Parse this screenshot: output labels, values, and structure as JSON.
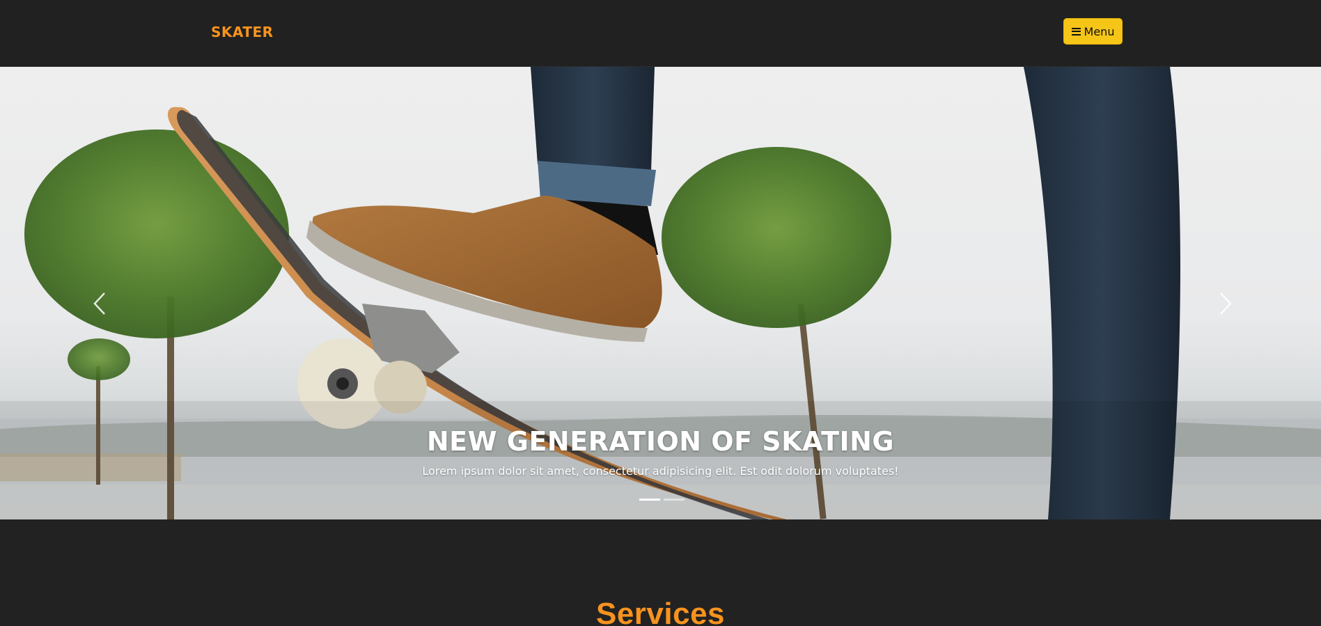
{
  "header": {
    "brand": "SKATER",
    "menu_label": "Menu",
    "menu_icon": "hamburger-icon"
  },
  "hero": {
    "title": "NEW GENERATION OF SKATING",
    "subtitle": "Lorem ipsum dolor sit amet, consectetur adipisicing elit. Est odit dolorum voluptates!",
    "prev_icon": "chevron-left-icon",
    "next_icon": "chevron-right-icon",
    "slides": [
      {
        "active": true
      },
      {
        "active": false
      }
    ]
  },
  "services": {
    "title": "Services"
  },
  "colors": {
    "background": "#222222",
    "brand": "#f7931e",
    "menu_button": "#f5c518",
    "text_light": "#ffffff"
  }
}
